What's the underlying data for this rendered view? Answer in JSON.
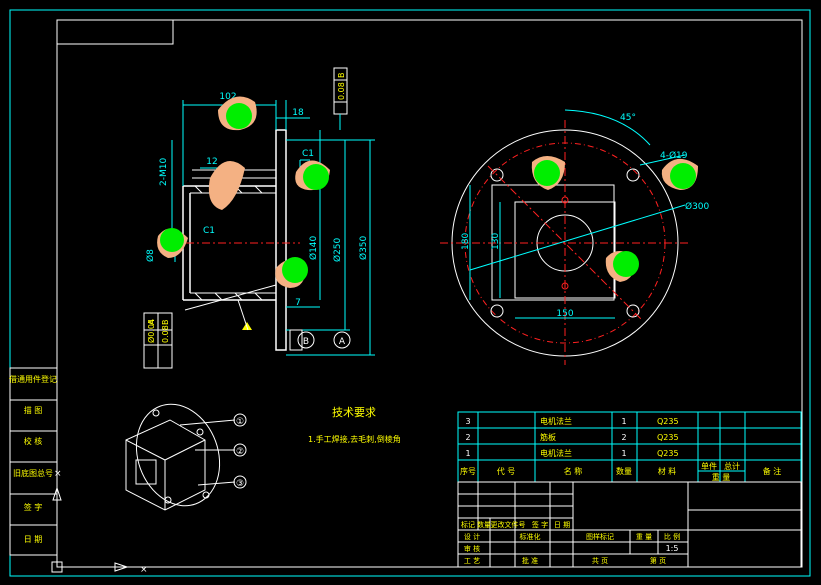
{
  "top_view": {
    "dim_top": "102",
    "dim_18": "18",
    "dim_m10": "2-M10",
    "dim_12": "12",
    "dim_c1_right": "C1",
    "dim_c1_left": "C1",
    "dim_phi_left": "Ø8",
    "dim_phi140": "Ø140",
    "dim_phi250": "Ø250",
    "dim_phi350": "Ø350",
    "dim_7": "7",
    "tol_top_a": "0.08",
    "tol_top_b": "B",
    "tol_left_1a": "Ø0.04",
    "tol_left_1b": "A",
    "tol_left_2a": "0.08",
    "tol_left_2b": "B",
    "datum_b": "B",
    "datum_a": "A"
  },
  "flange_view": {
    "angle": "45°",
    "holes": "4-Ø19",
    "dia300": "Ø300",
    "dim_180": "180",
    "dim_130": "130",
    "dim_150": "150"
  },
  "iso_view": {
    "balloon_1": "①",
    "balloon_2": "②",
    "balloon_3": "③"
  },
  "notes": {
    "title": "技术要求",
    "line1": "1.手工焊接,去毛刺,倒棱角"
  },
  "left_strip": {
    "items": [
      "借通用件登记",
      "描 图",
      "校 核",
      "旧底图总号",
      "签 字",
      "日 期"
    ]
  },
  "bom": {
    "rows": [
      {
        "no": "3",
        "name": "电机法兰",
        "qty": "1",
        "material": "Q235"
      },
      {
        "no": "2",
        "name": "筋板",
        "qty": "2",
        "material": "Q235"
      },
      {
        "no": "1",
        "name": "电机法兰",
        "qty": "1",
        "material": "Q235"
      }
    ],
    "header": {
      "no": "序号",
      "code": "代 号",
      "name": "名 称",
      "qty": "数量",
      "material": "材 料",
      "weight_single": "单件",
      "weight_total": "总计",
      "weight": "重 量",
      "remark": "备 注"
    }
  },
  "title_block": {
    "rev_cols": [
      "标记",
      "数量",
      "更改文件号",
      "签 字",
      "日 期"
    ],
    "row_design": "设 计",
    "row_std": "标准化",
    "row_check": "审 核",
    "row_process": "工 艺",
    "row_approve": "批 准",
    "stage_mark": "图样标记",
    "weight": "重 量",
    "scale": "比 例",
    "total_sheets": "共 页",
    "sheet": "第 页",
    "scale_value": "1:5"
  }
}
